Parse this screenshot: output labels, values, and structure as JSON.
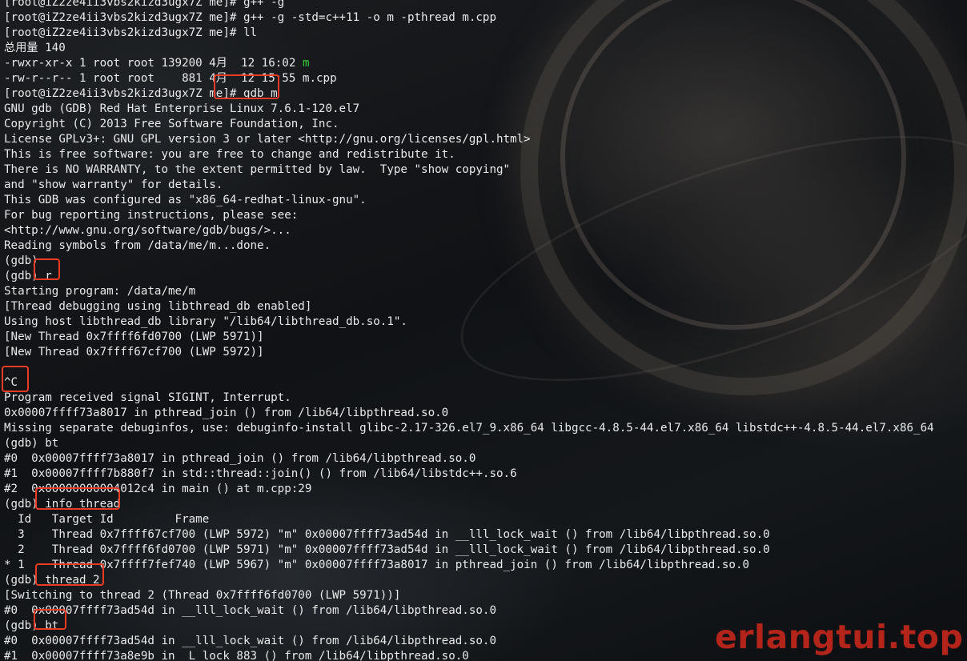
{
  "terminal": {
    "lines": [
      "[root@iZ2ze4ii3vbs2kizd3ugx7Z me]# g++ -g",
      "[root@iZ2ze4ii3vbs2kizd3ugx7Z me]# g++ -g -std=c++11 -o m -pthread m.cpp",
      "[root@iZ2ze4ii3vbs2kizd3ugx7Z me]# ll",
      "总用量 140",
      "-rwxr-xr-x 1 root root 139200 4月  12 16:02 ",
      "-rw-r--r-- 1 root root    881 4月  12 15:55 m.cpp",
      "[root@iZ2ze4ii3vbs2kizd3ugx7Z me]# gdb m",
      "GNU gdb (GDB) Red Hat Enterprise Linux 7.6.1-120.el7",
      "Copyright (C) 2013 Free Software Foundation, Inc.",
      "License GPLv3+: GNU GPL version 3 or later <http://gnu.org/licenses/gpl.html>",
      "This is free software: you are free to change and redistribute it.",
      "There is NO WARRANTY, to the extent permitted by law.  Type \"show copying\"",
      "and \"show warranty\" for details.",
      "This GDB was configured as \"x86_64-redhat-linux-gnu\".",
      "For bug reporting instructions, please see:",
      "<http://www.gnu.org/software/gdb/bugs/>...",
      "Reading symbols from /data/me/m...done.",
      "(gdb)",
      "(gdb) r",
      "Starting program: /data/me/m",
      "[Thread debugging using libthread_db enabled]",
      "Using host libthread_db library \"/lib64/libthread_db.so.1\".",
      "[New Thread 0x7ffff6fd0700 (LWP 5971)]",
      "[New Thread 0x7ffff67cf700 (LWP 5972)]",
      "",
      "^C",
      "Program received signal SIGINT, Interrupt.",
      "0x00007ffff73a8017 in pthread_join () from /lib64/libpthread.so.0",
      "Missing separate debuginfos, use: debuginfo-install glibc-2.17-326.el7_9.x86_64 libgcc-4.8.5-44.el7.x86_64 libstdc++-4.8.5-44.el7.x86_64",
      "(gdb) bt",
      "#0  0x00007ffff73a8017 in pthread_join () from /lib64/libpthread.so.0",
      "#1  0x00007ffff7b880f7 in std::thread::join() () from /lib64/libstdc++.so.6",
      "#2  0x00000000004012c4 in main () at m.cpp:29",
      "(gdb) info thread",
      "  Id   Target Id         Frame",
      "  3    Thread 0x7ffff67cf700 (LWP 5972) \"m\" 0x00007ffff73ad54d in __lll_lock_wait () from /lib64/libpthread.so.0",
      "  2    Thread 0x7ffff6fd0700 (LWP 5971) \"m\" 0x00007ffff73ad54d in __lll_lock_wait () from /lib64/libpthread.so.0",
      "* 1    Thread 0x7ffff7fef740 (LWP 5967) \"m\" 0x00007ffff73a8017 in pthread_join () from /lib64/libpthread.so.0",
      "(gdb) thread 2",
      "[Switching to thread 2 (Thread 0x7ffff6fd0700 (LWP 5971))]",
      "#0  0x00007ffff73ad54d in __lll_lock_wait () from /lib64/libpthread.so.0",
      "(gdb) bt",
      "#0  0x00007ffff73ad54d in __lll_lock_wait () from /lib64/libpthread.so.0",
      "#1  0x00007ffff73a8e9b in _L_lock_883 () from /lib64/libpthread.so.0"
    ],
    "exec_file_name": "m"
  },
  "watermark": {
    "text": "erlangtui.top"
  },
  "colors": {
    "text": "#e9e9e9",
    "exec_green": "#35d035",
    "highlight_red": "#ec3b24",
    "watermark_red": "#b3241a"
  }
}
